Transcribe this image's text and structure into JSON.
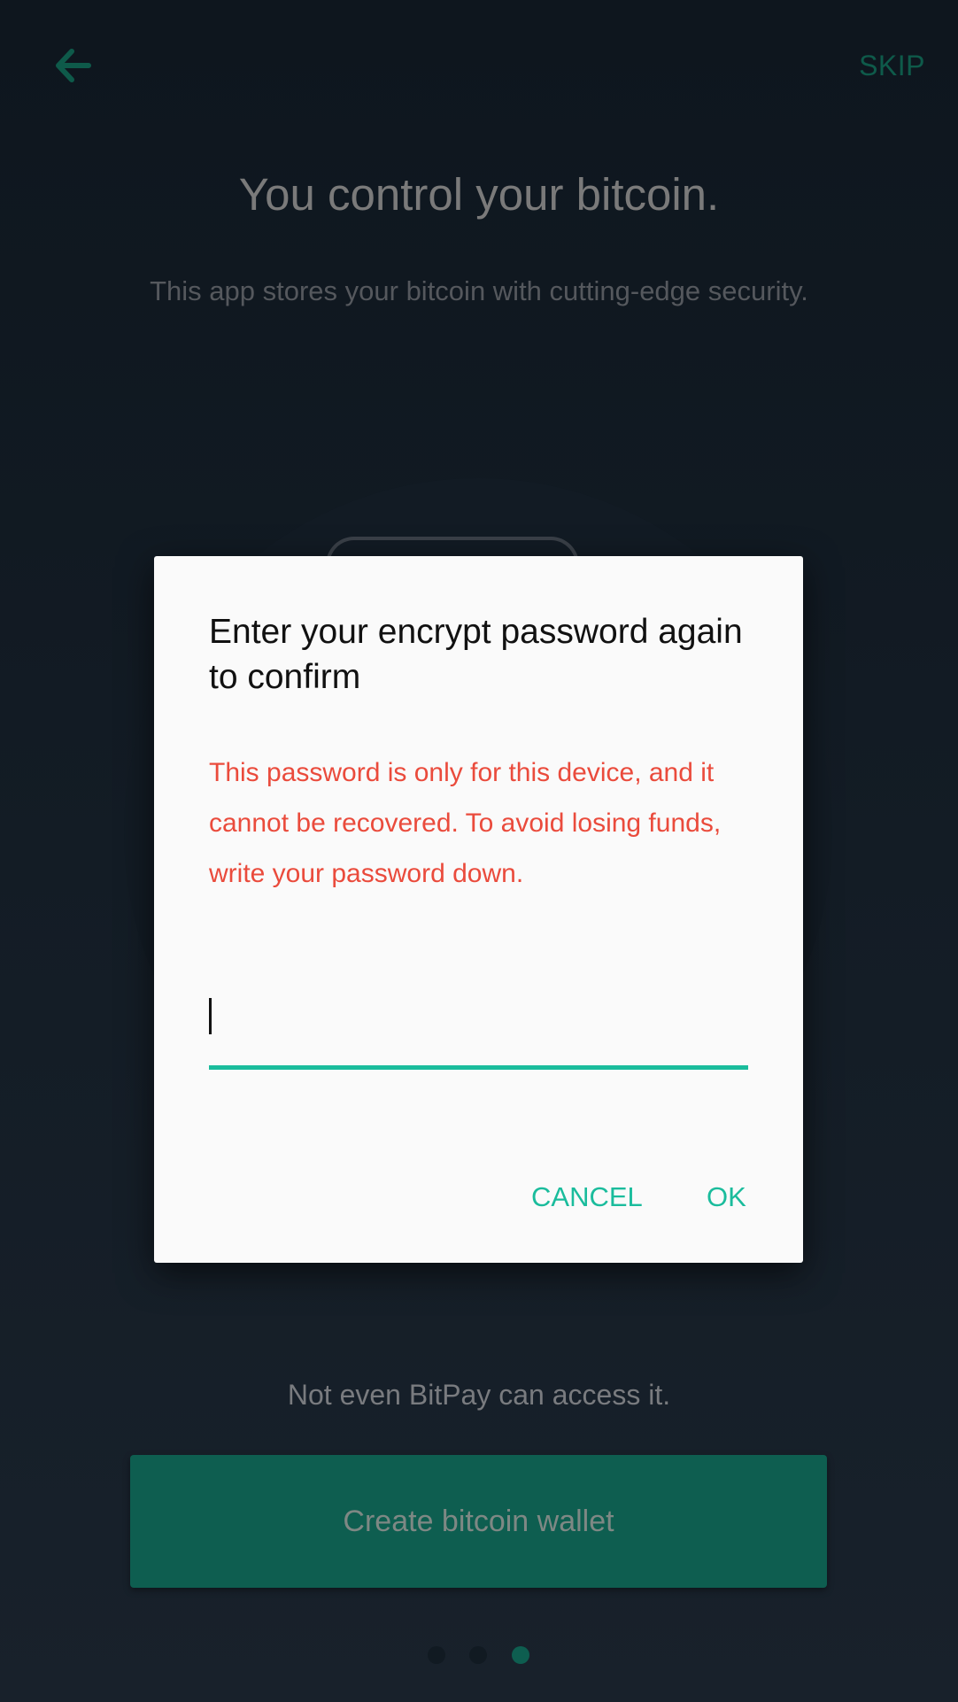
{
  "header": {
    "back_icon": "arrow-left-icon",
    "skip_label": "SKIP"
  },
  "onboarding": {
    "title": "You control your bitcoin.",
    "subtitle": "This app stores your bitcoin with cutting-edge security.",
    "footer_text": "Not even BitPay can access it.",
    "create_button": "Create bitcoin wallet",
    "pager": {
      "total": 3,
      "active_index": 2
    }
  },
  "dialog": {
    "title": "Enter your encrypt password again to confirm",
    "message": "This password is only for this device, and it cannot be recovered. To avoid losing funds, write your password down.",
    "password_value": "",
    "cancel_label": "CANCEL",
    "ok_label": "OK"
  },
  "colors": {
    "accent": "#1abc9c",
    "warning": "#ea4b3c",
    "brand_dark": "#0e5e50"
  }
}
